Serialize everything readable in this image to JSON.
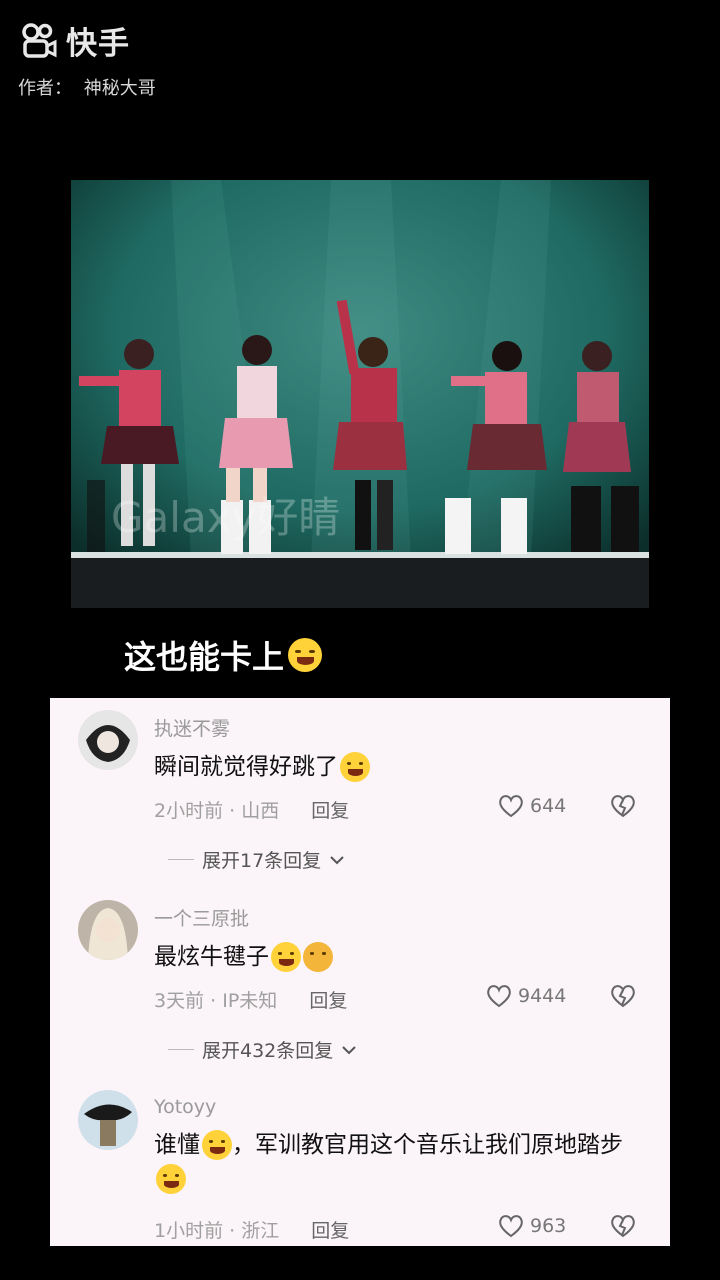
{
  "header": {
    "app_name": "快手",
    "author_label": "作者：",
    "author_name": "神秘大哥"
  },
  "video": {
    "watermark": "Galaxy好睛"
  },
  "caption": {
    "text": "这也能卡上"
  },
  "comments": [
    {
      "username": "执迷不雾",
      "text": "瞬间就觉得好跳了",
      "time": "2小时前",
      "location": "山西",
      "reply_label": "回复",
      "likes": "644",
      "expand_label": "展开17条回复"
    },
    {
      "username": "一个三原批",
      "text": "最炫牛毽子",
      "time": "3天前",
      "location": "IP未知",
      "reply_label": "回复",
      "likes": "9444",
      "expand_label": "展开432条回复"
    },
    {
      "username": "Yotoyy",
      "text_part1": "谁懂",
      "text_part2": "，军训教官用这个音乐让我们原地",
      "text_part3": "踏步",
      "time": "1小时前",
      "location": "浙江",
      "reply_label": "回复",
      "likes": "963"
    }
  ],
  "colors": {
    "background": "#000000",
    "comment_panel": "#fbf4f8",
    "stage": "#1f6b63"
  }
}
